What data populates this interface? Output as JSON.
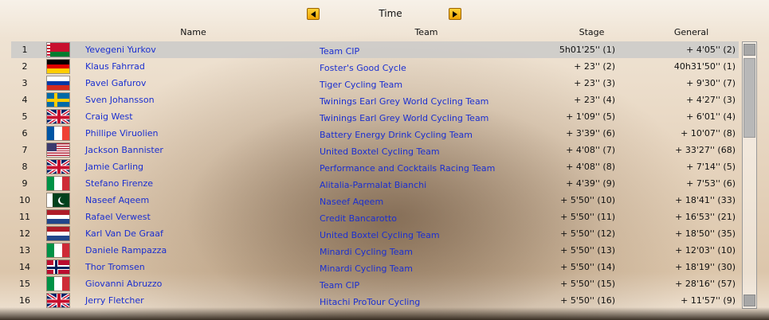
{
  "header": {
    "title": "Time",
    "columns": {
      "name": "Name",
      "team": "Team",
      "stage": "Stage",
      "general": "General"
    }
  },
  "icons": {
    "prev": "arrow-left-icon",
    "next": "arrow-right-icon"
  },
  "colors": {
    "link": "#1b2fd0",
    "accent": "#f0a400",
    "selected_row": "#c8c8c8"
  },
  "rows": [
    {
      "pos": "1",
      "flag": "belarus",
      "name": "Yevegeni Yurkov",
      "team": "Team CIP",
      "stage": "5h01'25'' (1)",
      "general": "+ 4'05'' (2)",
      "selected": true
    },
    {
      "pos": "2",
      "flag": "germany",
      "name": "Klaus Fahrrad",
      "team": "Foster's Good Cycle",
      "stage": "+ 23'' (2)",
      "general": "40h31'50'' (1)"
    },
    {
      "pos": "3",
      "flag": "russia",
      "name": "Pavel Gafurov",
      "team": "Tiger Cycling Team",
      "stage": "+ 23'' (3)",
      "general": "+ 9'30'' (7)"
    },
    {
      "pos": "4",
      "flag": "sweden",
      "name": "Sven Johansson",
      "team": "Twinings Earl Grey World Cycling Team",
      "stage": "+ 23'' (4)",
      "general": "+ 4'27'' (3)"
    },
    {
      "pos": "5",
      "flag": "uk",
      "name": "Craig West",
      "team": "Twinings Earl Grey World Cycling Team",
      "stage": "+ 1'09'' (5)",
      "general": "+ 6'01'' (4)"
    },
    {
      "pos": "6",
      "flag": "france",
      "name": "Phillipe Viruolien",
      "team": "Battery Energy Drink Cycling Team",
      "stage": "+ 3'39'' (6)",
      "general": "+ 10'07'' (8)"
    },
    {
      "pos": "7",
      "flag": "usa",
      "name": "Jackson Bannister",
      "team": "United Boxtel Cycling Team",
      "stage": "+ 4'08'' (7)",
      "general": "+ 33'27'' (68)"
    },
    {
      "pos": "8",
      "flag": "uk",
      "name": "Jamie Carling",
      "team": "Performance and Cocktails Racing Team",
      "stage": "+ 4'08'' (8)",
      "general": "+ 7'14'' (5)"
    },
    {
      "pos": "9",
      "flag": "italy",
      "name": "Stefano Firenze",
      "team": "Alitalia-Parmalat Bianchi",
      "stage": "+ 4'39'' (9)",
      "general": "+ 7'53'' (6)"
    },
    {
      "pos": "10",
      "flag": "pakistan",
      "name": "Naseef Aqeem",
      "team": "Naseef Aqeem",
      "stage": "+ 5'50'' (10)",
      "general": "+ 18'41'' (33)"
    },
    {
      "pos": "11",
      "flag": "netherlands",
      "name": "Rafael Verwest",
      "team": "Credit Bancarotto",
      "stage": "+ 5'50'' (11)",
      "general": "+ 16'53'' (21)"
    },
    {
      "pos": "12",
      "flag": "netherlands",
      "name": "Karl Van De Graaf",
      "team": "United Boxtel Cycling Team",
      "stage": "+ 5'50'' (12)",
      "general": "+ 18'50'' (35)"
    },
    {
      "pos": "13",
      "flag": "italy",
      "name": "Daniele Rampazza",
      "team": "Minardi Cycling Team",
      "stage": "+ 5'50'' (13)",
      "general": "+ 12'03'' (10)"
    },
    {
      "pos": "14",
      "flag": "norway",
      "name": "Thor Tromsen",
      "team": "Minardi Cycling Team",
      "stage": "+ 5'50'' (14)",
      "general": "+ 18'19'' (30)"
    },
    {
      "pos": "15",
      "flag": "italy",
      "name": "Giovanni Abruzzo",
      "team": "Team CIP",
      "stage": "+ 5'50'' (15)",
      "general": "+ 28'16'' (57)"
    },
    {
      "pos": "16",
      "flag": "uk",
      "name": "Jerry Fletcher",
      "team": "Hitachi ProTour Cycling",
      "stage": "+ 5'50'' (16)",
      "general": "+ 11'57'' (9)"
    }
  ]
}
